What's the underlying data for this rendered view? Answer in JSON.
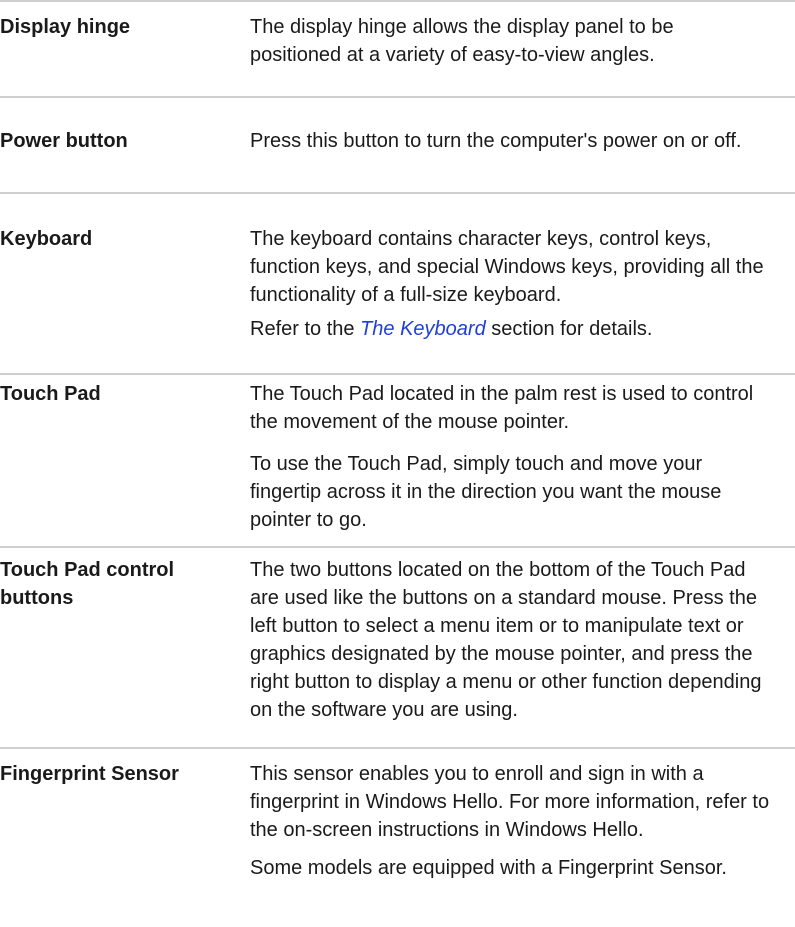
{
  "rows": [
    {
      "term": "Display hinge",
      "paragraphs": [
        "The display hinge allows the display panel to be positioned at a variety of easy-to-view angles."
      ]
    },
    {
      "term": "Power button",
      "paragraphs": [
        "Press this button to turn the computer's power on or off."
      ]
    },
    {
      "term": "Keyboard",
      "paragraphs": [
        "The keyboard contains character keys, control keys, function keys, and special Windows keys, providing all the functionality of a full-size keyboard."
      ],
      "refer": {
        "prefix": "Refer to the ",
        "link": "The Keyboard",
        "suffix": " section for details."
      }
    },
    {
      "term": "Touch Pad",
      "paragraphs": [
        "The Touch Pad located in the palm rest is used to control the movement of the mouse pointer.",
        "To use the Touch Pad, simply touch and move your fingertip across it in the direction you want the mouse pointer to go."
      ]
    },
    {
      "term": "Touch Pad control buttons",
      "paragraphs": [
        "The two buttons located on the bottom of the Touch Pad are used like the buttons on a standard mouse. Press the left button to select a menu item or to manipulate text or graphics designated by the mouse pointer, and press the right button to display a menu or other function depending on the software you are using."
      ]
    },
    {
      "term": "Fingerprint Sensor",
      "paragraphs": [
        "This sensor enables you to enroll and sign in with a fingerprint in Windows Hello. For more information, refer to the on-screen instructions in Windows Hello.",
        "Some models are equipped with a Fingerprint Sensor."
      ]
    }
  ]
}
